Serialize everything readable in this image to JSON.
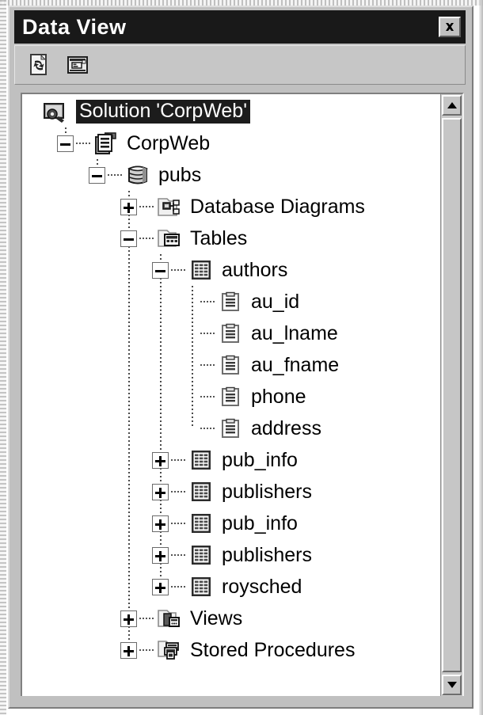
{
  "window": {
    "title": "Data View",
    "close_label": "x",
    "close_icon": "close-icon",
    "titlebar_color": "#191919",
    "face_color": "#c0c0c0"
  },
  "toolbar": {
    "buttons": [
      {
        "name": "refresh-query-button",
        "icon": "document-refresh-icon",
        "tooltip": "Refresh"
      },
      {
        "name": "new-database-object-button",
        "icon": "database-window-icon",
        "tooltip": "Design"
      }
    ]
  },
  "scrollbar": {
    "up_arrow": "scroll-up-arrow-icon",
    "down_arrow": "scroll-down-arrow-icon",
    "thumb": "scroll-thumb"
  },
  "tree": {
    "nodes": [
      {
        "id": "n0",
        "label": "Solution 'CorpWeb'",
        "depth": 0,
        "twisty": "none",
        "icon": "solution-icon",
        "selected": true
      },
      {
        "id": "n1",
        "label": "CorpWeb",
        "depth": 1,
        "twisty": "minus",
        "icon": "project-icon",
        "selected": false
      },
      {
        "id": "n2",
        "label": "pubs",
        "depth": 2,
        "twisty": "minus",
        "icon": "database-icon",
        "selected": false
      },
      {
        "id": "n3",
        "label": "Database Diagrams",
        "depth": 3,
        "twisty": "plus",
        "icon": "diagrams-folder-icon",
        "selected": false
      },
      {
        "id": "n4",
        "label": "Tables",
        "depth": 3,
        "twisty": "minus",
        "icon": "tables-folder-icon",
        "selected": false
      },
      {
        "id": "n5",
        "label": "authors",
        "depth": 4,
        "twisty": "minus",
        "icon": "table-icon",
        "selected": false
      },
      {
        "id": "n6",
        "label": "au_id",
        "depth": 5,
        "twisty": "leaf",
        "icon": "column-field-icon",
        "selected": false
      },
      {
        "id": "n7",
        "label": "au_lname",
        "depth": 5,
        "twisty": "leaf",
        "icon": "column-field-icon",
        "selected": false
      },
      {
        "id": "n8",
        "label": "au_fname",
        "depth": 5,
        "twisty": "leaf",
        "icon": "column-field-icon",
        "selected": false
      },
      {
        "id": "n9",
        "label": "phone",
        "depth": 5,
        "twisty": "leaf",
        "icon": "column-field-icon",
        "selected": false
      },
      {
        "id": "n10",
        "label": "address",
        "depth": 5,
        "twisty": "leaf",
        "icon": "column-field-icon",
        "selected": false
      },
      {
        "id": "n11",
        "label": "pub_info",
        "depth": 4,
        "twisty": "plus",
        "icon": "table-icon",
        "selected": false
      },
      {
        "id": "n12",
        "label": "publishers",
        "depth": 4,
        "twisty": "plus",
        "icon": "table-icon",
        "selected": false
      },
      {
        "id": "n13",
        "label": "pub_info",
        "depth": 4,
        "twisty": "plus",
        "icon": "table-icon",
        "selected": false
      },
      {
        "id": "n14",
        "label": "publishers",
        "depth": 4,
        "twisty": "plus",
        "icon": "table-icon",
        "selected": false
      },
      {
        "id": "n15",
        "label": "roysched",
        "depth": 4,
        "twisty": "plus",
        "icon": "table-icon",
        "selected": false
      },
      {
        "id": "n16",
        "label": "Views",
        "depth": 3,
        "twisty": "plus",
        "icon": "views-folder-icon",
        "selected": false
      },
      {
        "id": "n17",
        "label": "Stored Procedures",
        "depth": 3,
        "twisty": "plus",
        "icon": "procedures-folder-icon",
        "selected": false
      }
    ]
  }
}
